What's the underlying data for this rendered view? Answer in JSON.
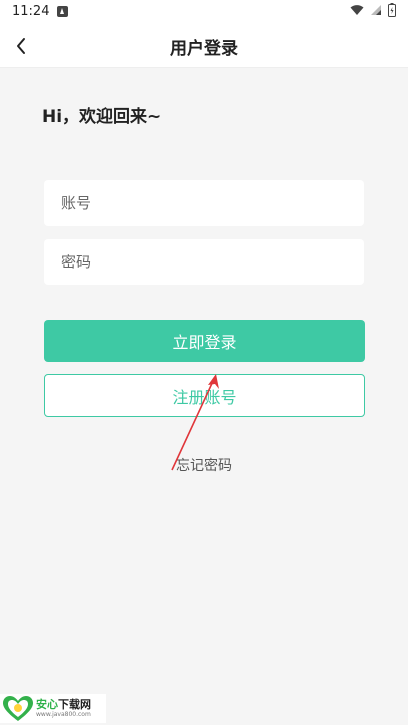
{
  "status_bar": {
    "time": "11:24",
    "icons": [
      "a-notification-icon",
      "wifi-icon",
      "signal-icon",
      "battery-icon"
    ]
  },
  "nav": {
    "title": "用户登录",
    "back_icon": "chevron-left-icon"
  },
  "greeting": "Hi，欢迎回来~",
  "form": {
    "account_placeholder": "账号",
    "account_value": "",
    "password_placeholder": "密码",
    "password_value": ""
  },
  "buttons": {
    "login_label": "立即登录",
    "register_label": "注册账号",
    "forgot_label": "忘记密码"
  },
  "watermark": {
    "title_green": "安心",
    "title_dark": "下载网",
    "url": "www.java800.com"
  },
  "colors": {
    "accent": "#3ec9a4",
    "background": "#f5f5f5",
    "annotation_arrow": "#e0363a"
  }
}
